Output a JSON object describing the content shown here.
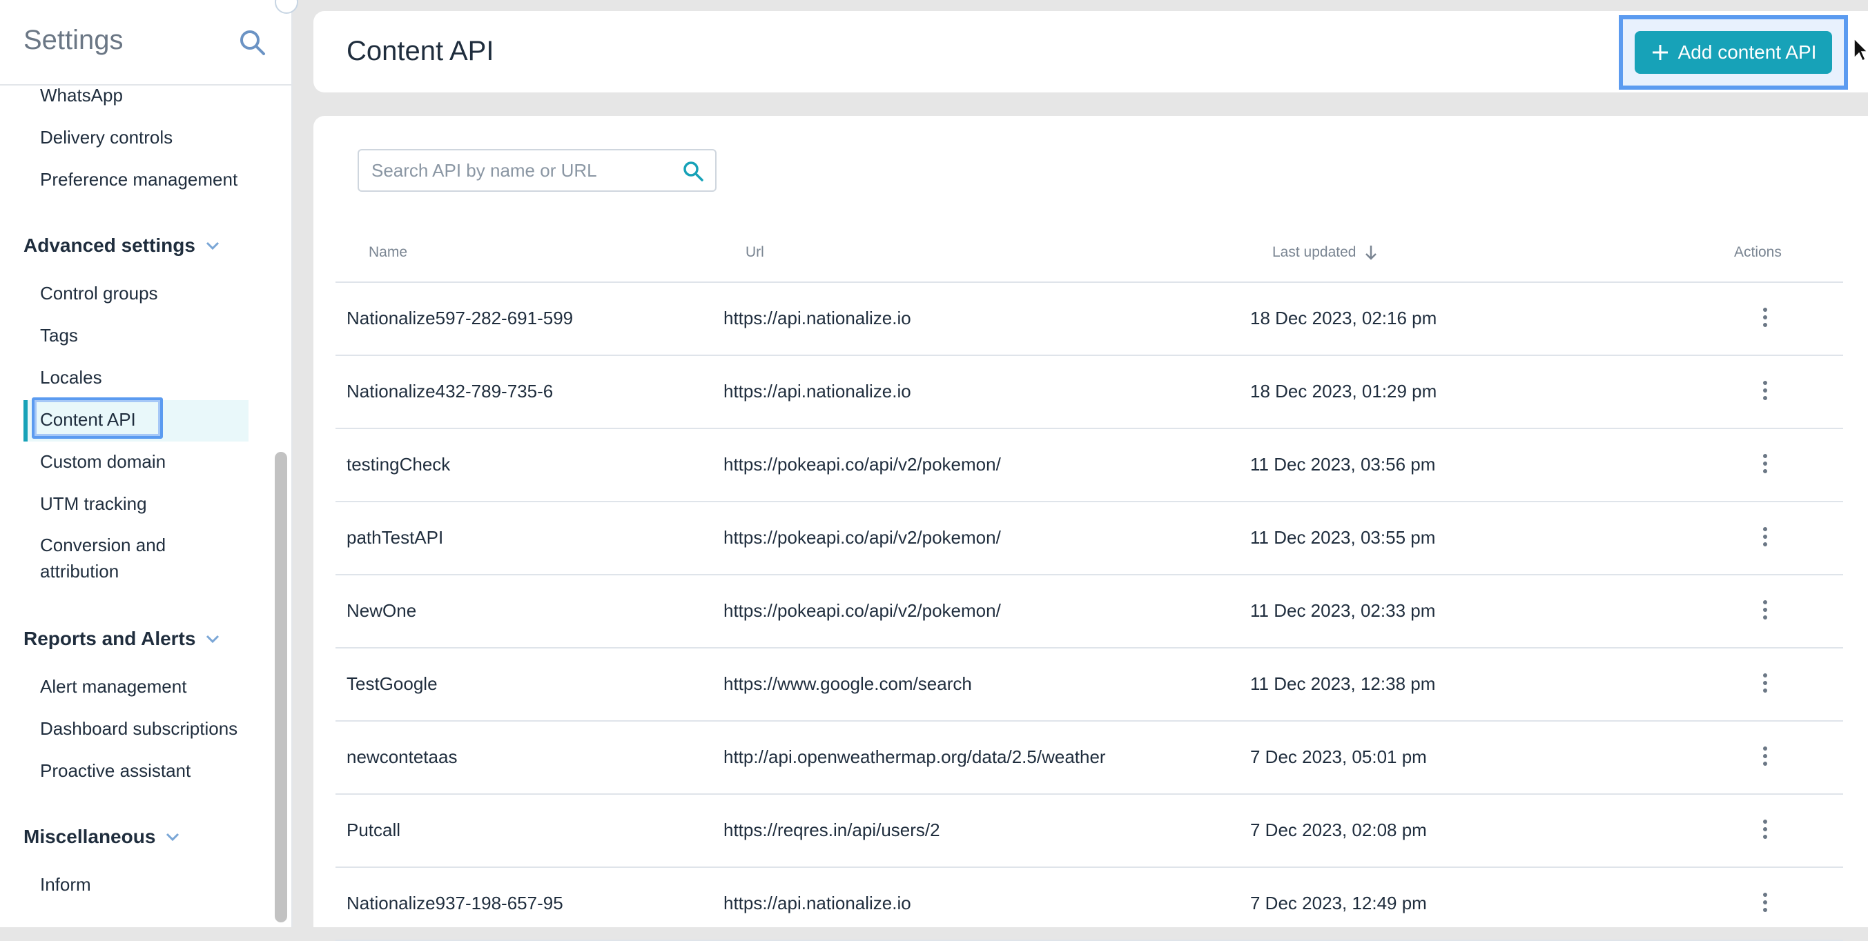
{
  "sidebar": {
    "title": "Settings",
    "items_top": [
      "WhatsApp",
      "Delivery controls",
      "Preference management"
    ],
    "sections": [
      {
        "label": "Advanced settings",
        "items": [
          "Control groups",
          "Tags",
          "Locales",
          "Content API",
          "Custom domain",
          "UTM tracking",
          "Conversion and",
          "attribution"
        ]
      },
      {
        "label": "Reports and Alerts",
        "items": [
          "Alert management",
          "Dashboard subscriptions",
          "Proactive assistant"
        ]
      },
      {
        "label": "Miscellaneous",
        "items": [
          "Inform"
        ]
      }
    ],
    "active_item": "Content API"
  },
  "header": {
    "title": "Content API",
    "add_button_label": "Add content API"
  },
  "search": {
    "placeholder": "Search API by name or URL",
    "value": ""
  },
  "table": {
    "columns": [
      "Name",
      "Url",
      "Last updated",
      "Actions"
    ],
    "rows": [
      {
        "name": "Nationalize597-282-691-599",
        "url": "https://api.nationalize.io",
        "updated": "18 Dec 2023, 02:16 pm"
      },
      {
        "name": "Nationalize432-789-735-6",
        "url": "https://api.nationalize.io",
        "updated": "18 Dec 2023, 01:29 pm"
      },
      {
        "name": "testingCheck",
        "url": "https://pokeapi.co/api/v2/pokemon/",
        "updated": "11 Dec 2023, 03:56 pm"
      },
      {
        "name": "pathTestAPI",
        "url": "https://pokeapi.co/api/v2/pokemon/",
        "updated": "11 Dec 2023, 03:55 pm"
      },
      {
        "name": "NewOne",
        "url": "https://pokeapi.co/api/v2/pokemon/",
        "updated": "11 Dec 2023, 02:33 pm"
      },
      {
        "name": "TestGoogle",
        "url": "https://www.google.com/search",
        "updated": "11 Dec 2023, 12:38 pm"
      },
      {
        "name": "newcontetaas",
        "url": "http://api.openweathermap.org/data/2.5/weather",
        "updated": "7 Dec 2023, 05:01 pm"
      },
      {
        "name": "Putcall",
        "url": "https://reqres.in/api/users/2",
        "updated": "7 Dec 2023, 02:08 pm"
      },
      {
        "name": "Nationalize937-198-657-95",
        "url": "https://api.nationalize.io",
        "updated": "7 Dec 2023, 12:49 pm"
      }
    ]
  },
  "colors": {
    "accent": "#17a2b8",
    "highlight": "#5b9bf0"
  }
}
